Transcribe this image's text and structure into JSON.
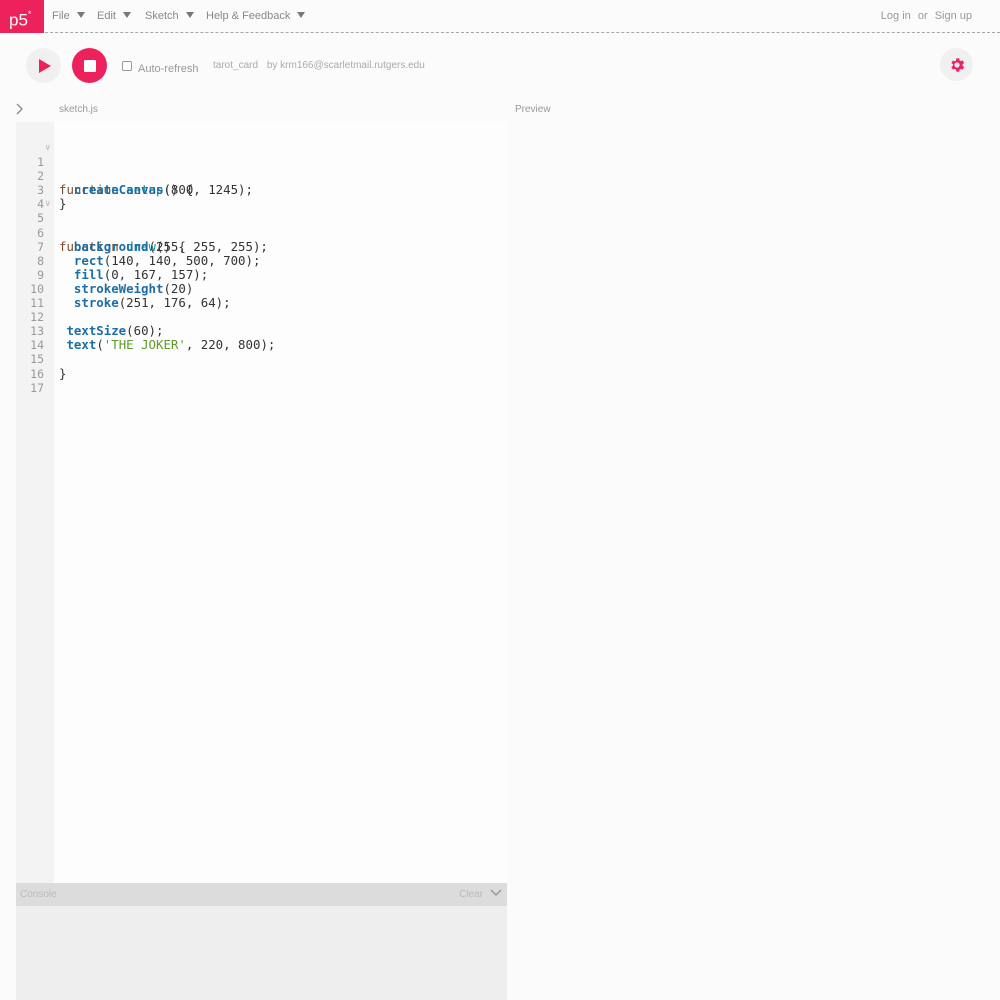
{
  "nav": {
    "logo": "p5",
    "logo_sup": "*",
    "menus": [
      {
        "label": "File"
      },
      {
        "label": "Edit"
      },
      {
        "label": "Sketch"
      },
      {
        "label": "Help & Feedback"
      }
    ],
    "login": "Log in",
    "or": "or",
    "signup": "Sign up"
  },
  "toolbar": {
    "auto_refresh_label": "Auto-refresh",
    "auto_refresh_checked": false,
    "sketch_name": "tarot_card",
    "author": "by krm166@scarletmail.rutgers.edu"
  },
  "editor": {
    "file_tab": "sketch.js",
    "preview_label": "Preview",
    "lines": [
      {
        "n": "1",
        "fold": true
      },
      {
        "n": "2"
      },
      {
        "n": "3"
      },
      {
        "n": "4"
      },
      {
        "n": "5",
        "fold": true
      },
      {
        "n": "6"
      },
      {
        "n": "7"
      },
      {
        "n": "8"
      },
      {
        "n": "9"
      },
      {
        "n": "10"
      },
      {
        "n": "11"
      },
      {
        "n": "12"
      },
      {
        "n": "13"
      },
      {
        "n": "14"
      },
      {
        "n": "15"
      },
      {
        "n": "16"
      },
      {
        "n": "17"
      }
    ],
    "code": {
      "l1_kw": "function",
      "l1_fn": "setup",
      "l1_rest": "() {",
      "l2_bi": "createCanvas",
      "l2_rest": "(800, 1245);",
      "l3": "}",
      "l5_kw": "function",
      "l5_fn": "draw",
      "l5_rest": "() {",
      "l6_bi": "background",
      "l6_rest": "(255, 255, 255);",
      "l7_bi": "rect",
      "l7_rest": "(140, 140, 500, 700);",
      "l8_bi": "fill",
      "l8_rest": "(0, 167, 157);",
      "l9_bi": "strokeWeight",
      "l9_rest": "(20)",
      "l10_bi": "stroke",
      "l10_rest": "(251, 176, 64);",
      "l12_bi": "textSize",
      "l12_rest": "(60);",
      "l13_bi": "text",
      "l13_open": "(",
      "l13_str": "'THE JOKER'",
      "l13_rest": ", 220, 800);",
      "l15": "}"
    }
  },
  "console": {
    "title": "Console",
    "clear": "Clear"
  },
  "colors": {
    "accent": "#ed225d"
  }
}
